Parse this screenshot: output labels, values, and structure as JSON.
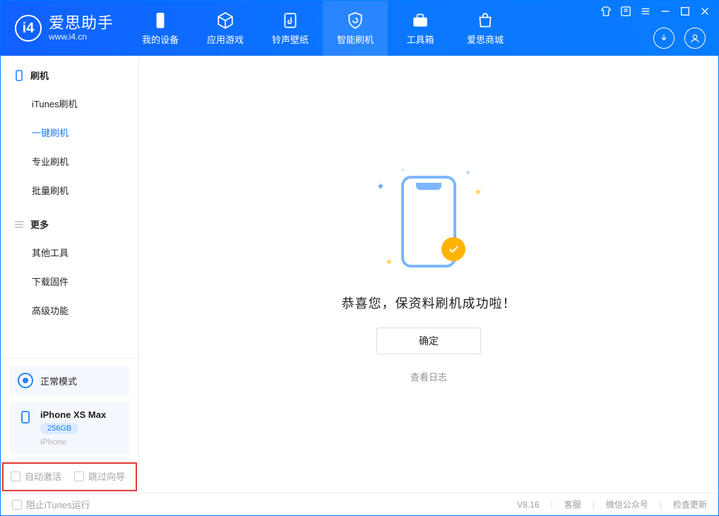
{
  "brand": {
    "title": "爱思助手",
    "subtitle": "www.i4.cn"
  },
  "header_tabs": [
    {
      "label": "我的设备"
    },
    {
      "label": "应用游戏"
    },
    {
      "label": "铃声壁纸"
    },
    {
      "label": "智能刷机"
    },
    {
      "label": "工具箱"
    },
    {
      "label": "爱思商城"
    }
  ],
  "sidebar": {
    "group1": {
      "title": "刷机",
      "items": [
        {
          "label": "iTunes刷机"
        },
        {
          "label": "一键刷机"
        },
        {
          "label": "专业刷机"
        },
        {
          "label": "批量刷机"
        }
      ]
    },
    "group2": {
      "title": "更多",
      "items": [
        {
          "label": "其他工具"
        },
        {
          "label": "下载固件"
        },
        {
          "label": "高级功能"
        }
      ]
    },
    "mode": {
      "label": "正常模式"
    },
    "device": {
      "name": "iPhone XS Max",
      "storage": "256GB",
      "type": "iPhone"
    },
    "checks": {
      "auto_activate": "自动激活",
      "skip_guide": "跳过向导"
    }
  },
  "main": {
    "success_text": "恭喜您，保资料刷机成功啦！",
    "ok_label": "确定",
    "log_link": "查看日志"
  },
  "footer": {
    "block_itunes": "阻止iTunes运行",
    "version": "V8.16",
    "links": [
      "客服",
      "微信公众号",
      "检查更新"
    ]
  }
}
